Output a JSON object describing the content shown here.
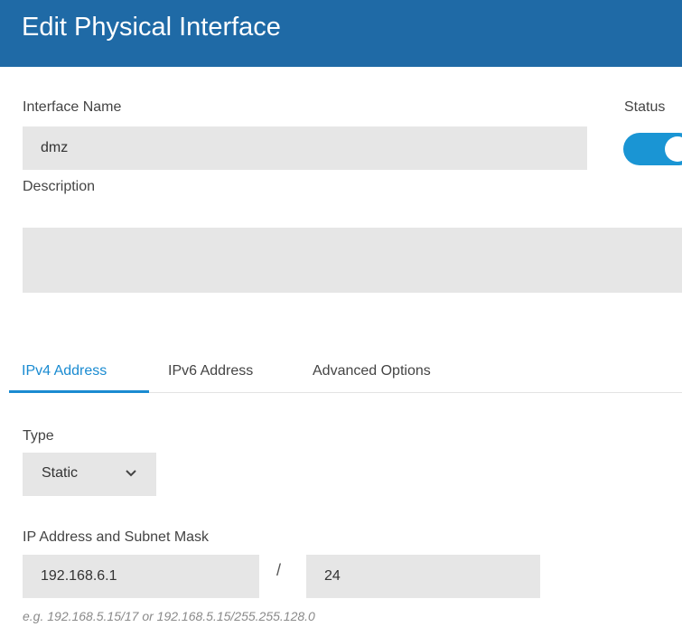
{
  "dialog": {
    "title": "Edit Physical Interface"
  },
  "form": {
    "interface_name_label": "Interface Name",
    "interface_name_value": "dmz",
    "status_label": "Status",
    "status_enabled": true,
    "description_label": "Description",
    "description_value": ""
  },
  "tabs": [
    {
      "label": "IPv4 Address",
      "active": true
    },
    {
      "label": "IPv6 Address",
      "active": false
    },
    {
      "label": "Advanced Options",
      "active": false
    }
  ],
  "ipv4": {
    "type_label": "Type",
    "type_value": "Static",
    "ip_label": "IP Address and Subnet Mask",
    "ip_value": "192.168.6.1",
    "separator": "/",
    "mask_value": "24",
    "hint": "e.g. 192.168.5.15/17 or 192.168.5.15/255.255.128.0"
  },
  "colors": {
    "header_bg": "#1f6aa6",
    "accent": "#1a8bd1",
    "toggle_on": "#1a95d4",
    "field_bg": "#e6e6e6"
  },
  "icons": {
    "select_chevron": "chevron-down-icon"
  }
}
